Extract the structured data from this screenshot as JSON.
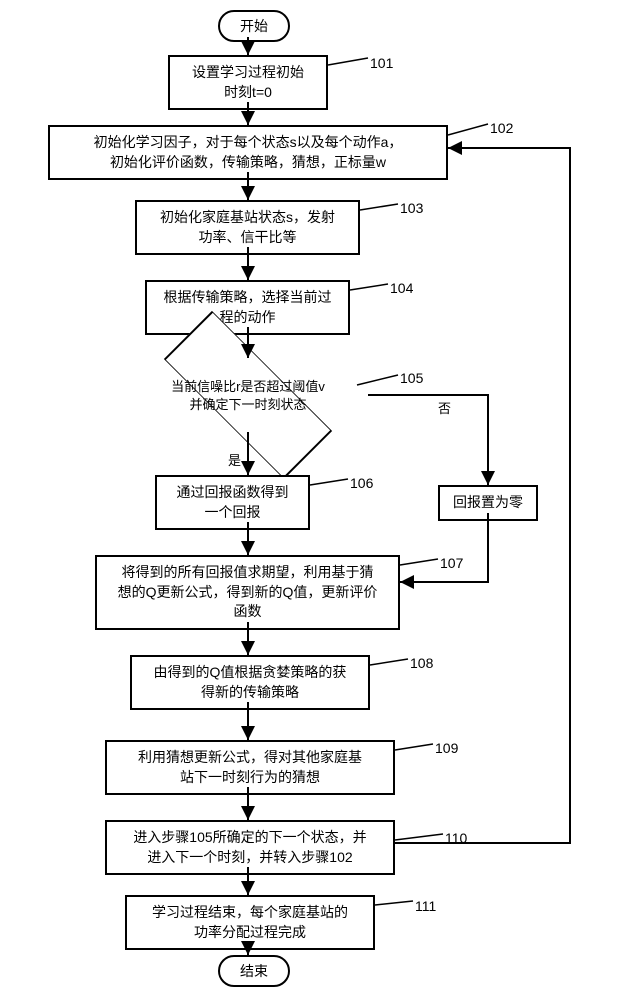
{
  "chart_data": {
    "type": "flowchart",
    "start": "开始",
    "end": "结束",
    "steps": [
      {
        "ref": "101",
        "text": "设置学习过程初始\n时刻t=0"
      },
      {
        "ref": "102",
        "text": "初始化学习因子，对于每个状态s以及每个动作a，\n初始化评价函数，传输策略，猜想，正标量w"
      },
      {
        "ref": "103",
        "text": "初始化家庭基站状态s，发射\n功率、信干比等"
      },
      {
        "ref": "104",
        "text": "根据传输策略，选择当前过\n程的动作"
      },
      {
        "ref": "105",
        "type": "decision",
        "text": "当前信噪比r是否超过阈值v\n并确定下一时刻状态",
        "yes": "是",
        "no": "否"
      },
      {
        "ref": "106",
        "text": "通过回报函数得到\n一个回报"
      },
      {
        "ref": "106b",
        "text": "回报置为零"
      },
      {
        "ref": "107",
        "text": "将得到的所有回报值求期望，利用基于猜\n想的Q更新公式，得到新的Q值，更新评价\n函数"
      },
      {
        "ref": "108",
        "text": "由得到的Q值根据贪婪策略的获\n得新的传输策略"
      },
      {
        "ref": "109",
        "text": "利用猜想更新公式，得对其他家庭基\n站下一时刻行为的猜想"
      },
      {
        "ref": "110",
        "text": "进入步骤105所确定的下一个状态，并\n进入下一个时刻，并转入步骤102"
      },
      {
        "ref": "111",
        "text": "学习过程结束，每个家庭基站的\n功率分配过程完成"
      }
    ],
    "ref_labels": {
      "r101": "101",
      "r102": "102",
      "r103": "103",
      "r104": "104",
      "r105": "105",
      "r106": "106",
      "r107": "107",
      "r108": "108",
      "r109": "109",
      "r110": "110",
      "r111": "111"
    }
  }
}
